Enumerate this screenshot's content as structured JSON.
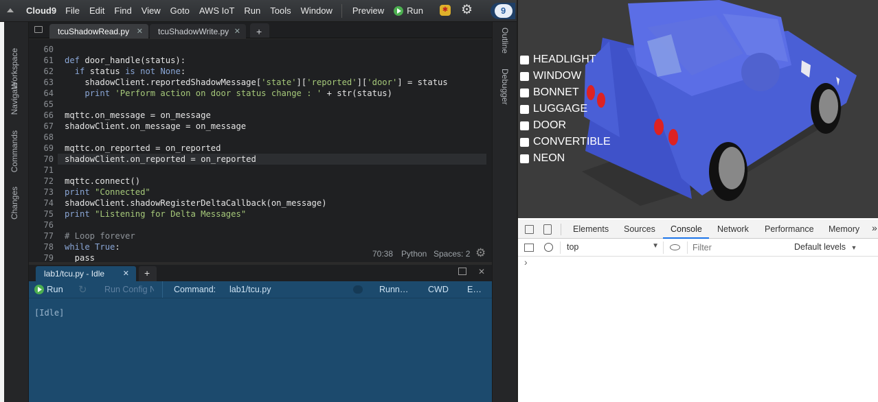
{
  "ide": {
    "brand": "Cloud9",
    "menu": [
      "File",
      "Edit",
      "Find",
      "View",
      "Goto",
      "AWS IoT",
      "Run",
      "Tools",
      "Window"
    ],
    "preview_label": "Preview",
    "run_label": "Run",
    "badge_count": "9",
    "left_panels": [
      "Workspace",
      "Navigate",
      "Commands",
      "Changes"
    ],
    "right_panels": [
      "Outline",
      "Debugger"
    ],
    "tabs": [
      {
        "label": "tcuShadowRead.py",
        "active": true
      },
      {
        "label": "tcuShadowWrite.py",
        "active": false
      }
    ],
    "code": [
      {
        "n": "60",
        "t": ""
      },
      {
        "n": "61",
        "t": "def door_handle(status):"
      },
      {
        "n": "62",
        "t": "  if status is not None:"
      },
      {
        "n": "63",
        "t": "    shadowClient.reportedShadowMessage['state']['reported']['door'] = status"
      },
      {
        "n": "64",
        "t": "    print 'Perform action on door status change : ' + str(status)"
      },
      {
        "n": "65",
        "t": ""
      },
      {
        "n": "66",
        "t": "mqttc.on_message = on_message"
      },
      {
        "n": "67",
        "t": "shadowClient.on_message = on_message"
      },
      {
        "n": "68",
        "t": ""
      },
      {
        "n": "69",
        "t": "mqttc.on_reported = on_reported"
      },
      {
        "n": "70",
        "t": "shadowClient.on_reported = on_reported"
      },
      {
        "n": "71",
        "t": ""
      },
      {
        "n": "72",
        "t": "mqttc.connect()"
      },
      {
        "n": "73",
        "t": "print \"Connected\""
      },
      {
        "n": "74",
        "t": "shadowClient.shadowRegisterDeltaCallback(on_message)"
      },
      {
        "n": "75",
        "t": "print \"Listening for Delta Messages\""
      },
      {
        "n": "76",
        "t": ""
      },
      {
        "n": "77",
        "t": "# Loop forever"
      },
      {
        "n": "78",
        "t": "while True:"
      },
      {
        "n": "79",
        "t": "  pass"
      }
    ],
    "status": {
      "position": "70:38",
      "language": "Python",
      "spaces": "Spaces: 2"
    },
    "bottom_tab": "lab1/tcu.py - Idle",
    "run_toolbar": {
      "run": "Run",
      "run_config": "Run Config N",
      "command_label": "Command:",
      "command_value": "lab1/tcu.py",
      "runner": "Runn…",
      "cwd": "CWD",
      "env": "E…"
    },
    "console_text": "[Idle]"
  },
  "viewer": {
    "checkboxes": [
      "HEADLIGHT",
      "WINDOW",
      "BONNET",
      "LUGGAGE",
      "DOOR",
      "CONVERTIBLE",
      "NEON"
    ],
    "car_color": "#4a5fd6"
  },
  "devtools": {
    "tabs": [
      "Elements",
      "Sources",
      "Console",
      "Network",
      "Performance",
      "Memory"
    ],
    "active_tab": "Console",
    "context": "top",
    "filter_placeholder": "Filter",
    "levels": "Default levels",
    "prompt": "›"
  }
}
